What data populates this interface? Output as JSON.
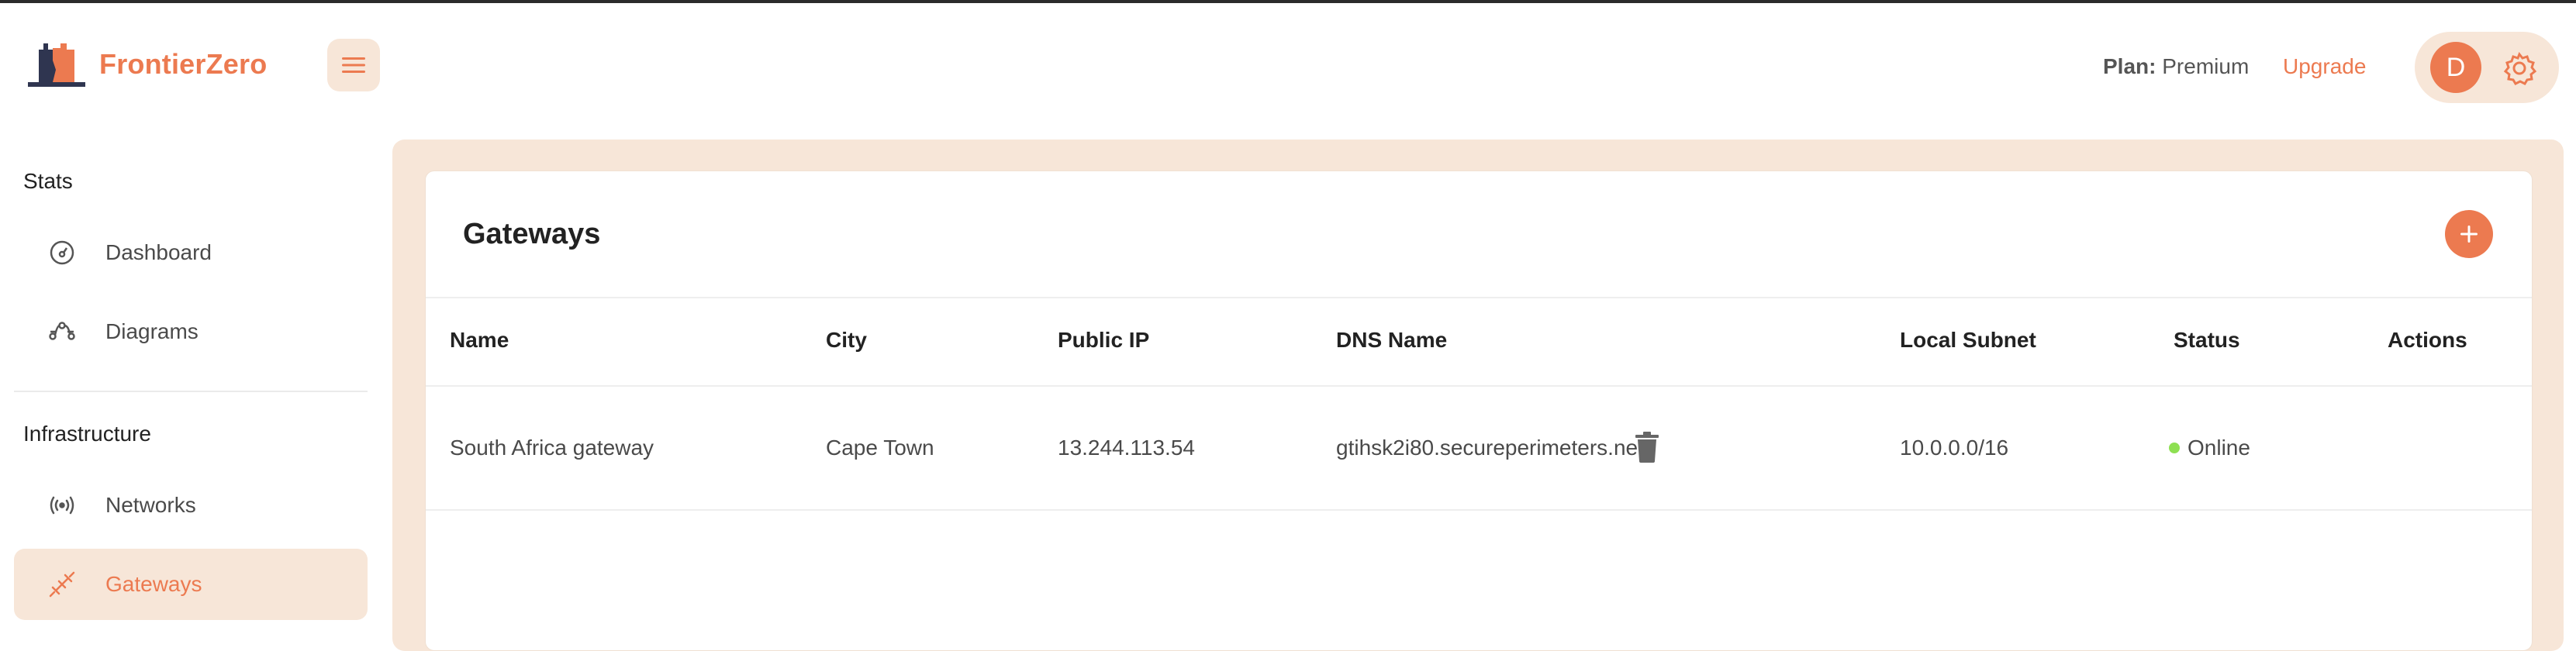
{
  "app": {
    "name": "FrontierZero"
  },
  "header": {
    "plan_label": "Plan:",
    "plan_value": "Premium",
    "upgrade_label": "Upgrade",
    "avatar_initial": "D"
  },
  "sidebar": {
    "sections": [
      {
        "title": "Stats",
        "items": [
          {
            "label": "Dashboard",
            "icon": "gauge-icon"
          },
          {
            "label": "Diagrams",
            "icon": "diagram-icon"
          }
        ]
      },
      {
        "title": "Infrastructure",
        "items": [
          {
            "label": "Networks",
            "icon": "broadcast-icon"
          },
          {
            "label": "Gateways",
            "icon": "gateway-icon",
            "active": true
          }
        ]
      }
    ]
  },
  "main": {
    "title": "Gateways",
    "columns": [
      "Name",
      "City",
      "Public IP",
      "DNS Name",
      "Local Subnet",
      "Status",
      "Actions"
    ],
    "rows": [
      {
        "name": "South Africa gateway",
        "city": "Cape Town",
        "public_ip": "13.244.113.54",
        "dns_name": "gtihsk2i80.secureperimeters.net",
        "local_subnet": "10.0.0.0/16",
        "status": "Online"
      }
    ]
  },
  "colors": {
    "accent": "#ec7a50",
    "accent_light": "#f7e6d8",
    "online": "#8ee052"
  }
}
